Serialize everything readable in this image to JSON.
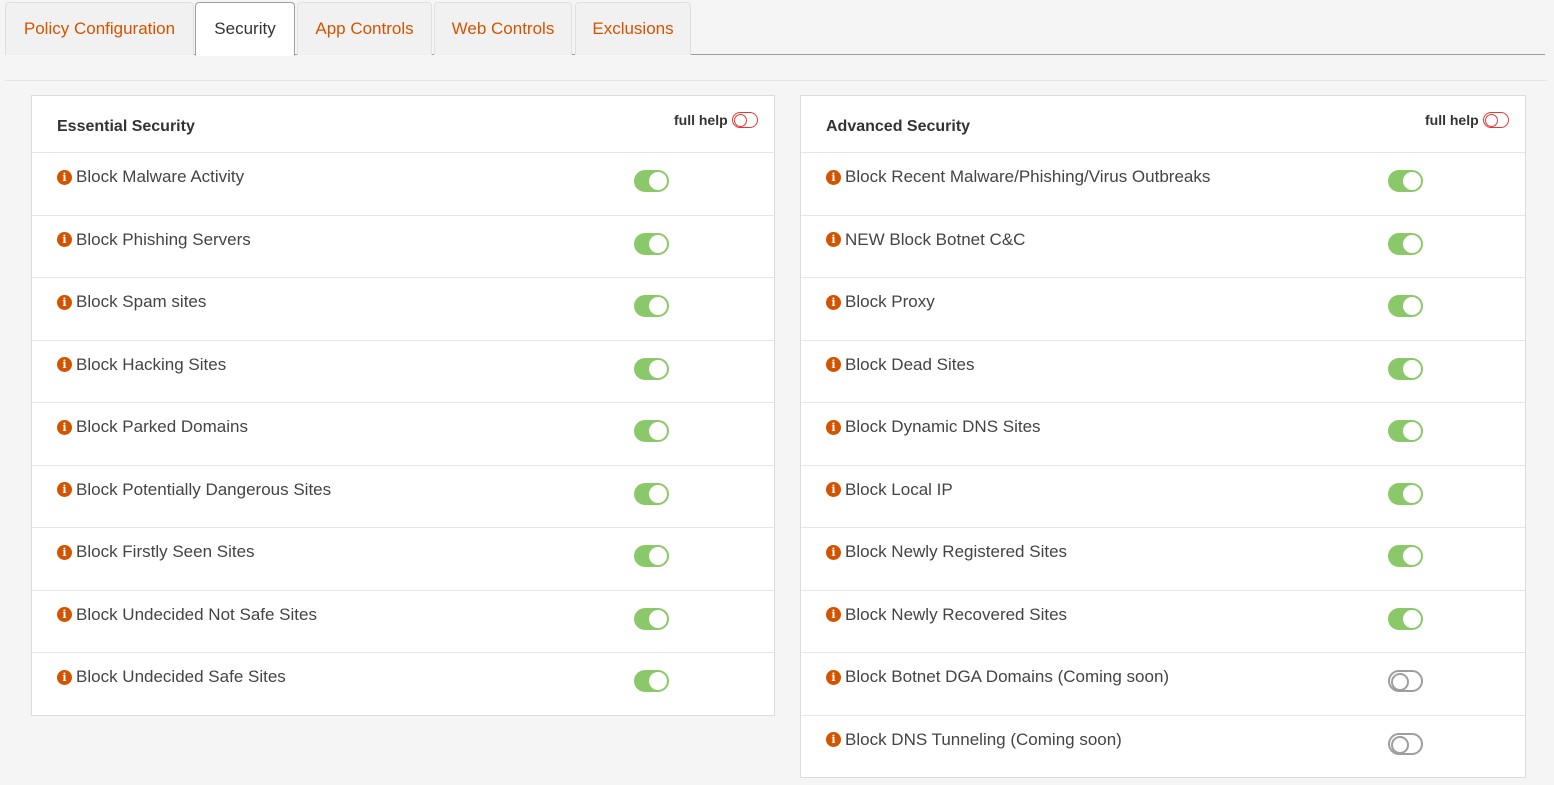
{
  "tabs": [
    {
      "label": "Policy Configuration",
      "active": false
    },
    {
      "label": "Security",
      "active": true
    },
    {
      "label": "App Controls",
      "active": false
    },
    {
      "label": "Web Controls",
      "active": false
    },
    {
      "label": "Exclusions",
      "active": false
    }
  ],
  "essential": {
    "title": "Essential Security",
    "full_help_label": "full help",
    "full_help_on": false,
    "items": [
      {
        "label": "Block Malware Activity",
        "enabled": true
      },
      {
        "label": "Block Phishing Servers",
        "enabled": true
      },
      {
        "label": "Block Spam sites",
        "enabled": true
      },
      {
        "label": "Block Hacking Sites",
        "enabled": true
      },
      {
        "label": "Block Parked Domains",
        "enabled": true
      },
      {
        "label": "Block Potentially Dangerous Sites",
        "enabled": true
      },
      {
        "label": "Block Firstly Seen Sites",
        "enabled": true
      },
      {
        "label": "Block Undecided Not Safe Sites",
        "enabled": true
      },
      {
        "label": "Block Undecided Safe Sites",
        "enabled": true
      }
    ]
  },
  "advanced": {
    "title": "Advanced Security",
    "full_help_label": "full help",
    "full_help_on": false,
    "items": [
      {
        "label": "Block Recent Malware/Phishing/Virus Outbreaks",
        "enabled": true
      },
      {
        "label": "NEW Block Botnet C&C",
        "enabled": true
      },
      {
        "label": "Block Proxy",
        "enabled": true
      },
      {
        "label": "Block Dead Sites",
        "enabled": true
      },
      {
        "label": "Block Dynamic DNS Sites",
        "enabled": true
      },
      {
        "label": "Block Local IP",
        "enabled": true
      },
      {
        "label": "Block Newly Registered Sites",
        "enabled": true
      },
      {
        "label": "Block Newly Recovered Sites",
        "enabled": true
      },
      {
        "label": "Block Botnet DGA Domains (Coming soon)",
        "enabled": false
      },
      {
        "label": "Block DNS Tunneling (Coming soon)",
        "enabled": false
      }
    ]
  },
  "info_icon_glyph": "i",
  "colors": {
    "accent": "#d35400",
    "toggle_on": "#8bc86a",
    "toggle_off": "#9e9e9e",
    "help_toggle": "#e53935"
  }
}
